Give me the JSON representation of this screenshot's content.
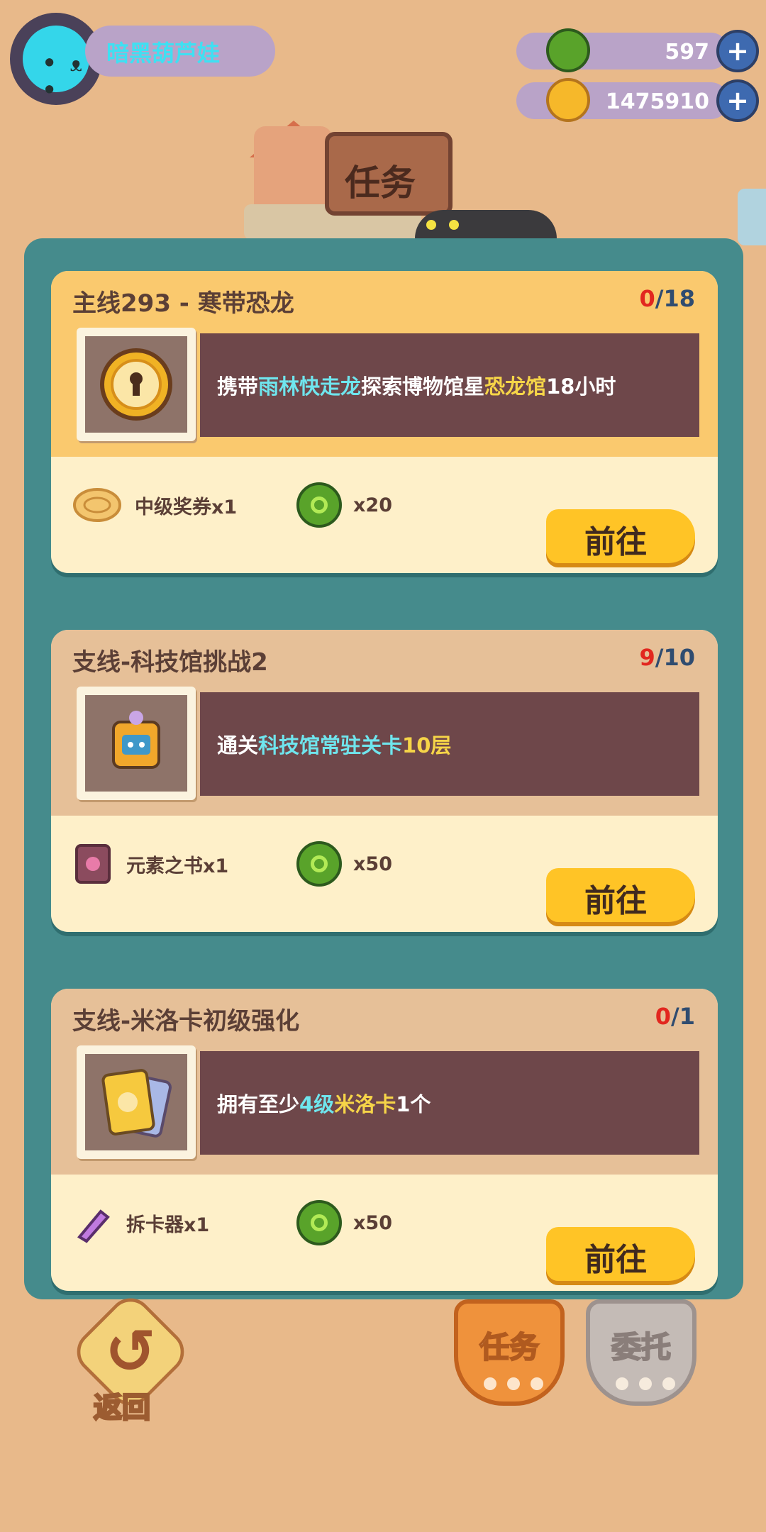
{
  "player": {
    "name": "暗黑葫芦娃"
  },
  "currency": {
    "green": {
      "value": "597",
      "icon": "green-donut-coin-icon"
    },
    "gold": {
      "value": "1475910",
      "icon": "gold-planet-coin-icon"
    }
  },
  "page": {
    "title": "任务"
  },
  "tasks": [
    {
      "title": "主线293 - 寒带恐龙",
      "progress_current": "0",
      "progress_total": "/18",
      "desc_parts": [
        "携带",
        "雨林快走龙",
        "探索博物馆星",
        "恐龙馆",
        "18小时"
      ],
      "thumb_icon": "keyhole-coin-icon",
      "rewards": [
        {
          "icon": "ticket-icon",
          "label": "中级奖券x1"
        },
        {
          "icon": "green-donut-coin-icon",
          "label": "x20"
        }
      ],
      "button": "前往",
      "style": "gold"
    },
    {
      "title": "支线-科技馆挑战2",
      "progress_current": "9",
      "progress_total": "/10",
      "desc_parts": [
        "通关",
        "科技馆常驻关卡",
        "10层"
      ],
      "thumb_icon": "robot-backpack-icon",
      "rewards": [
        {
          "icon": "book-icon",
          "label": "元素之书x1"
        },
        {
          "icon": "green-donut-coin-icon",
          "label": "x50"
        }
      ],
      "button": "前往",
      "style": "tan"
    },
    {
      "title": "支线-米洛卡初级强化",
      "progress_current": "0",
      "progress_total": "/1",
      "desc_parts": [
        "拥有至少",
        "4级",
        "米洛卡",
        "1个"
      ],
      "thumb_icon": "cards-icon",
      "rewards": [
        {
          "icon": "card-opener-icon",
          "label": "拆卡器x1"
        },
        {
          "icon": "green-donut-coin-icon",
          "label": "x50"
        }
      ],
      "button": "前往",
      "style": "tan"
    }
  ],
  "bottom": {
    "back_label": "返回",
    "tab_tasks": "任务",
    "tab_commission": "委托"
  },
  "colors": {
    "panel": "#458b8c",
    "accent_red": "#e2271f",
    "highlight_cyan": "#6fe5ed",
    "highlight_yellow": "#f6d548",
    "button_yellow": "#ffc426"
  }
}
